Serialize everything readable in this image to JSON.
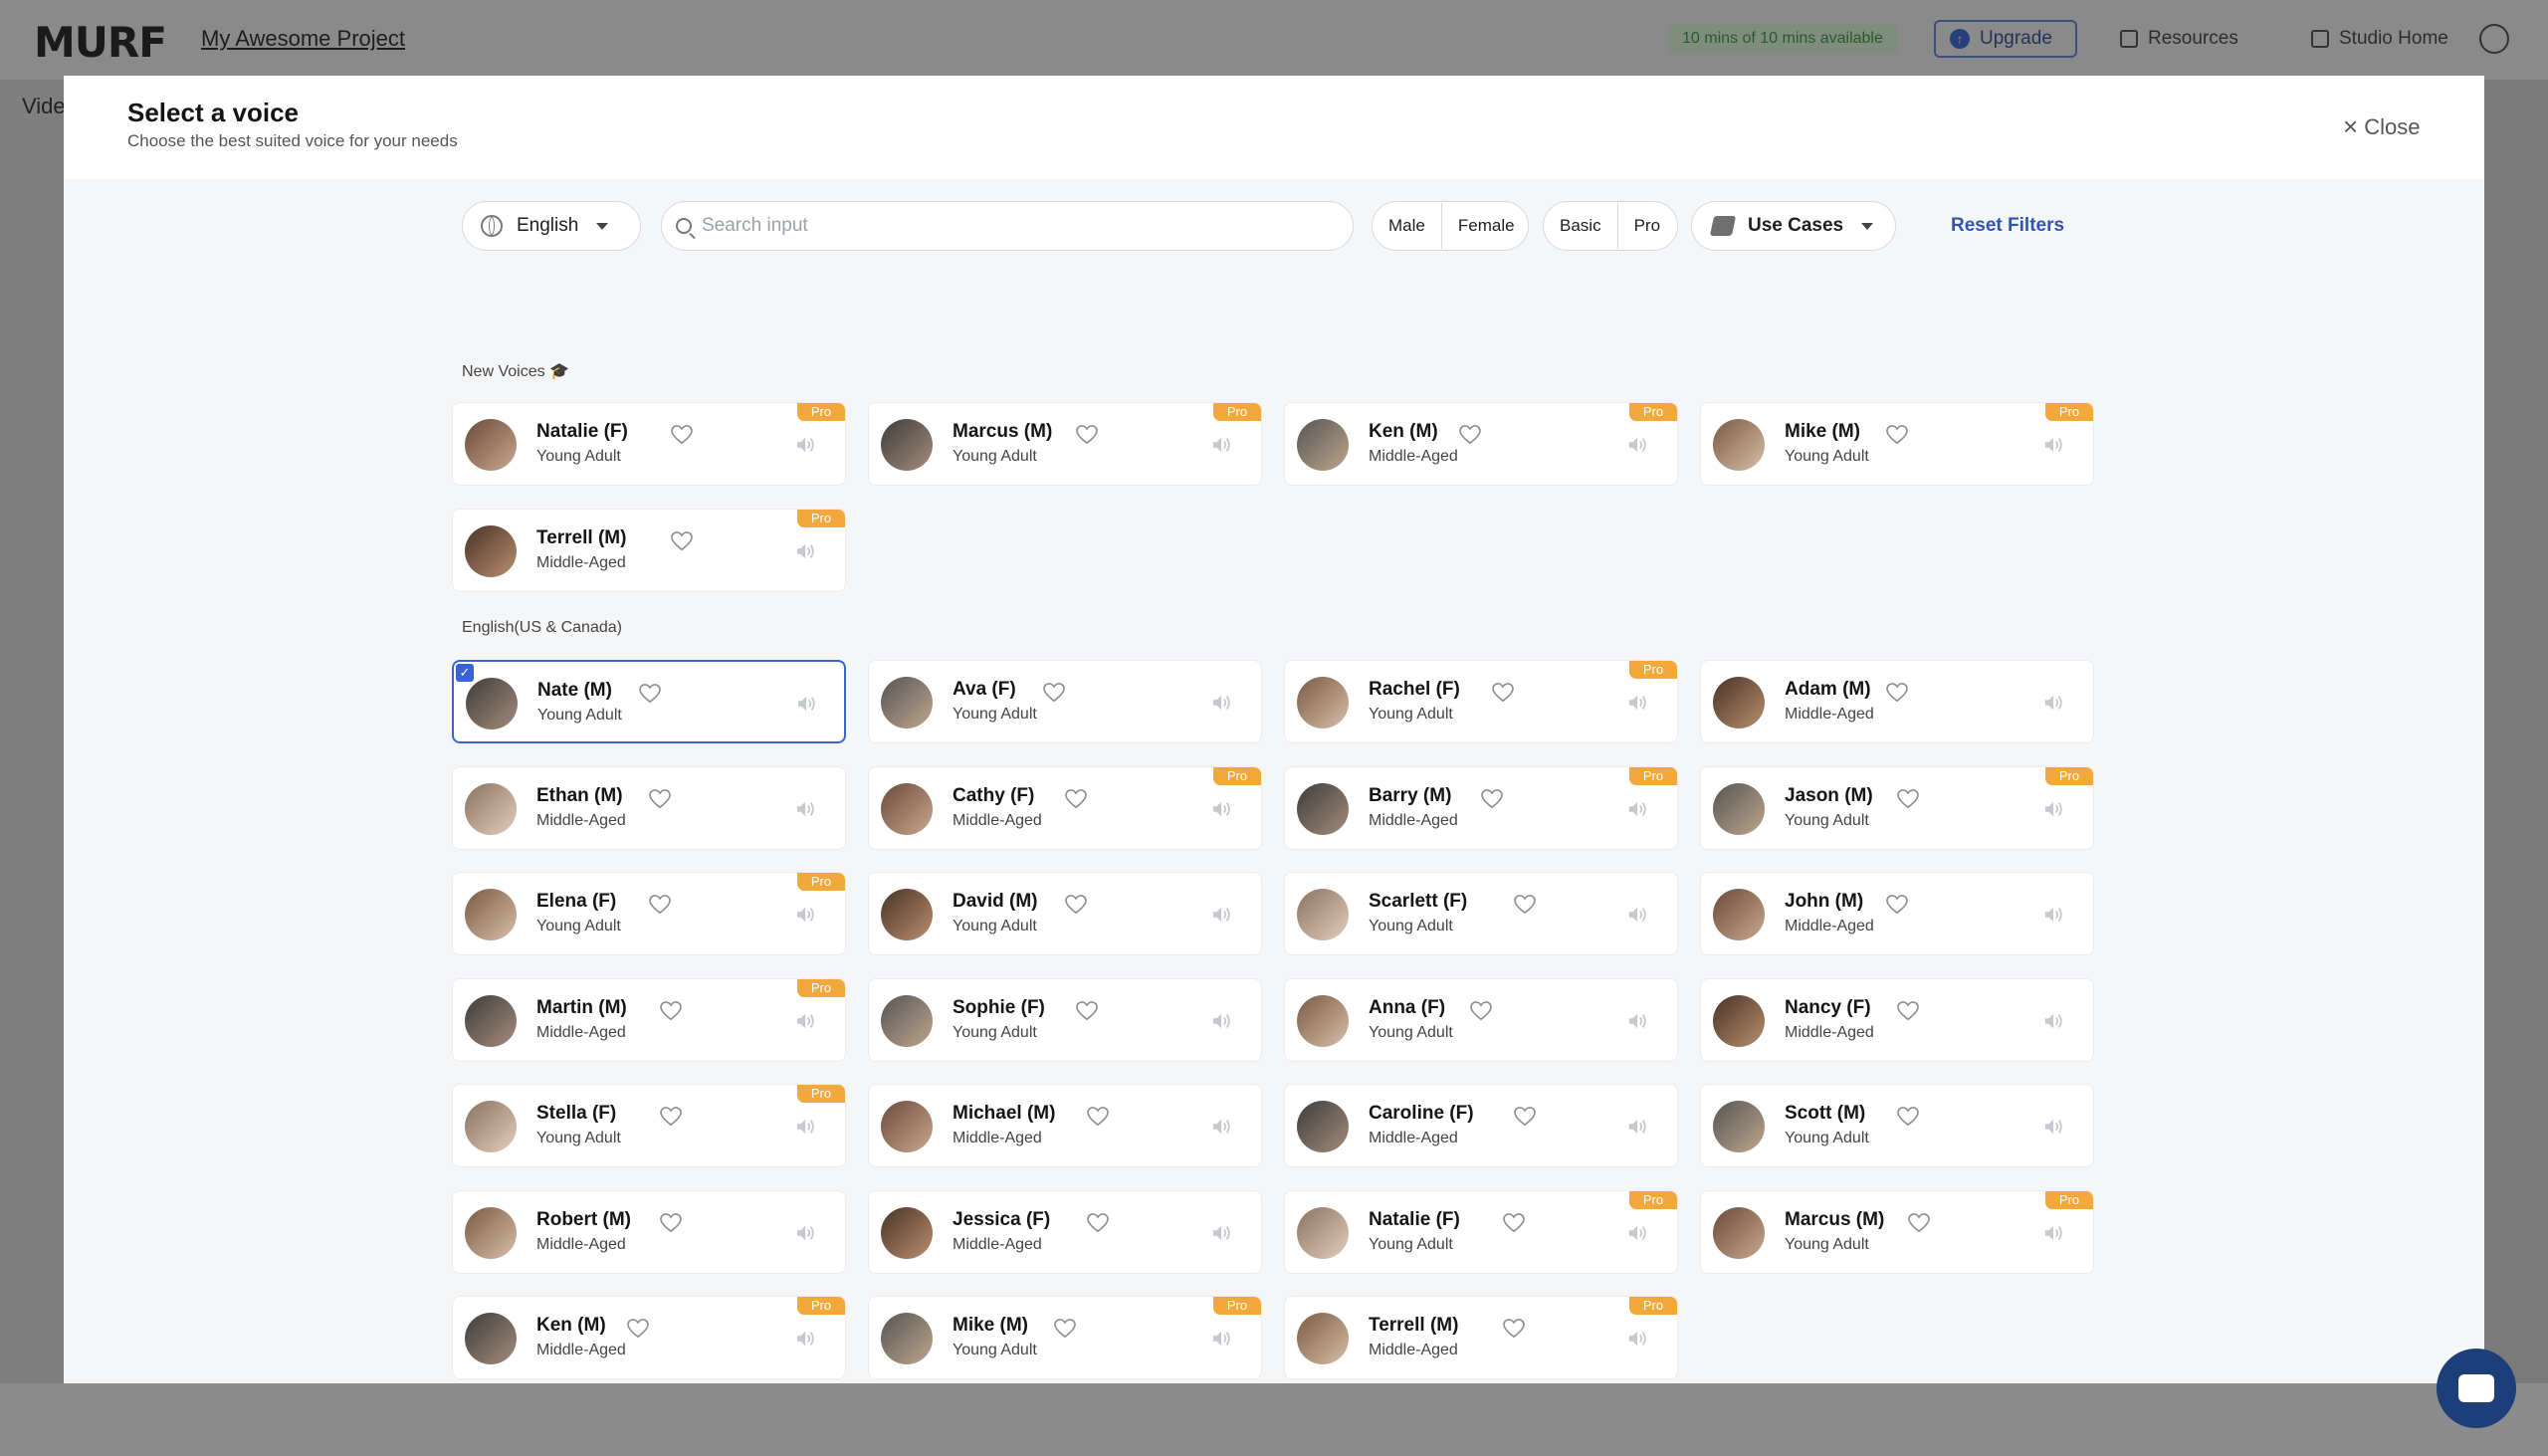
{
  "app": {
    "logo": "MURF",
    "project_name": "My Awesome Project",
    "quota": "10 mins of 10 mins available",
    "upgrade_label": "Upgrade",
    "resources_label": "Resources",
    "studio_home_label": "Studio Home",
    "bg_partial_text": "Vide"
  },
  "modal": {
    "title": "Select a voice",
    "subtitle": "Choose the best suited voice for your needs",
    "close_label": "Close"
  },
  "filters": {
    "language": "English",
    "search_placeholder": "Search input",
    "gender_options": [
      "Male",
      "Female"
    ],
    "tier_options": [
      "Basic",
      "Pro"
    ],
    "use_cases_label": "Use Cases",
    "reset_label": "Reset Filters"
  },
  "colors": {
    "accent": "#3a63d8",
    "pro_badge": "#f2a83b",
    "reset_link": "#2f55b4"
  },
  "pro_badge_label": "Pro",
  "sections": [
    {
      "label": "New Voices 🎓",
      "voices": [
        {
          "name": "Natalie (F)",
          "age": "Young Adult",
          "pro": true
        },
        {
          "name": "Marcus (M)",
          "age": "Young Adult",
          "pro": true
        },
        {
          "name": "Ken (M)",
          "age": "Middle-Aged",
          "pro": true
        },
        {
          "name": "Mike (M)",
          "age": "Young Adult",
          "pro": true
        },
        {
          "name": "Terrell (M)",
          "age": "Middle-Aged",
          "pro": true
        }
      ]
    },
    {
      "label": "English(US & Canada)",
      "voices": [
        {
          "name": "Nate (M)",
          "age": "Young Adult",
          "pro": false,
          "selected": true
        },
        {
          "name": "Ava (F)",
          "age": "Young Adult",
          "pro": false
        },
        {
          "name": "Rachel (F)",
          "age": "Young Adult",
          "pro": true
        },
        {
          "name": "Adam (M)",
          "age": "Middle-Aged",
          "pro": false
        },
        {
          "name": "Ethan (M)",
          "age": "Middle-Aged",
          "pro": false
        },
        {
          "name": "Cathy (F)",
          "age": "Middle-Aged",
          "pro": true
        },
        {
          "name": "Barry (M)",
          "age": "Middle-Aged",
          "pro": true
        },
        {
          "name": "Jason (M)",
          "age": "Young Adult",
          "pro": true
        },
        {
          "name": "Elena (F)",
          "age": "Young Adult",
          "pro": true
        },
        {
          "name": "David (M)",
          "age": "Young Adult",
          "pro": false
        },
        {
          "name": "Scarlett (F)",
          "age": "Young Adult",
          "pro": false
        },
        {
          "name": "John (M)",
          "age": "Middle-Aged",
          "pro": false
        },
        {
          "name": "Martin (M)",
          "age": "Middle-Aged",
          "pro": true
        },
        {
          "name": "Sophie (F)",
          "age": "Young Adult",
          "pro": false
        },
        {
          "name": "Anna (F)",
          "age": "Young Adult",
          "pro": false
        },
        {
          "name": "Nancy (F)",
          "age": "Middle-Aged",
          "pro": false
        },
        {
          "name": "Stella (F)",
          "age": "Young Adult",
          "pro": true
        },
        {
          "name": "Michael (M)",
          "age": "Middle-Aged",
          "pro": false
        },
        {
          "name": "Caroline (F)",
          "age": "Middle-Aged",
          "pro": false
        },
        {
          "name": "Scott (M)",
          "age": "Young Adult",
          "pro": false
        },
        {
          "name": "Robert (M)",
          "age": "Middle-Aged",
          "pro": false
        },
        {
          "name": "Jessica (F)",
          "age": "Middle-Aged",
          "pro": false
        },
        {
          "name": "Natalie (F)",
          "age": "Young Adult",
          "pro": true
        },
        {
          "name": "Marcus (M)",
          "age": "Young Adult",
          "pro": true
        },
        {
          "name": "Ken (M)",
          "age": "Middle-Aged",
          "pro": true
        },
        {
          "name": "Mike (M)",
          "age": "Young Adult",
          "pro": true
        },
        {
          "name": "Terrell (M)",
          "age": "Middle-Aged",
          "pro": true
        }
      ]
    }
  ]
}
